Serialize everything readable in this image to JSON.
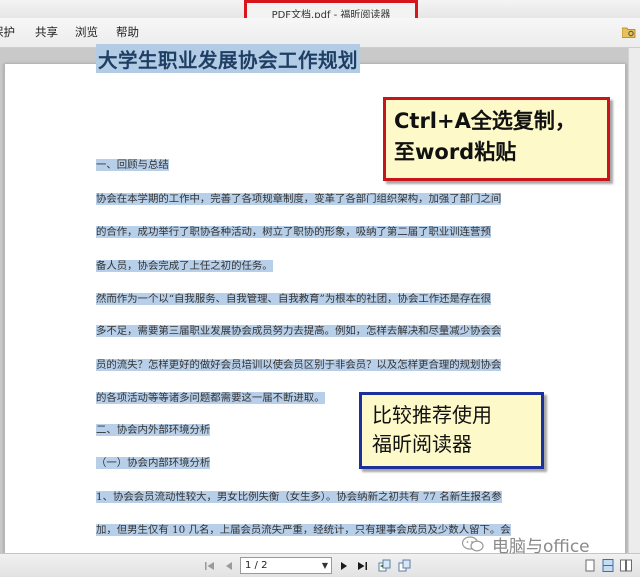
{
  "window": {
    "title": "PDF文档.pdf - 福昕阅读器"
  },
  "menu": {
    "items": [
      {
        "label": "保护",
        "name": "menu-protect"
      },
      {
        "label": "共享",
        "name": "menu-share"
      },
      {
        "label": "浏览",
        "name": "menu-view"
      },
      {
        "label": "帮助",
        "name": "menu-help"
      }
    ]
  },
  "document": {
    "title": "大学生职业发展协会工作规划",
    "lines": [
      {
        "text": "一、回顾与总结",
        "highlight": true
      },
      {
        "text": "协会在本学期的工作中，完善了各项规章制度，变革了各部门组织架构，加强了部门之间",
        "highlight": true
      },
      {
        "text": "的合作，成功举行了职协各种活动，树立了职协的形象，吸纳了第二届了职业训连营预",
        "highlight": true
      },
      {
        "text": "备人员，协会完成了上任之初的任务。",
        "highlight": true
      },
      {
        "text": "然而作为一个以“自我服务、自我管理、自我教育”为根本的社团，协会工作还是存在很",
        "highlight": true
      },
      {
        "text": "多不足，需要第三届职业发展协会成员努力去提高。例如，怎样去解决和尽量减少协会会",
        "highlight": true
      },
      {
        "text": "员的流失？怎样更好的做好会员培训以使会员区别于非会员？以及怎样更合理的规划协会",
        "highlight": true
      },
      {
        "text": "的各项活动等等诸多问题都需要这一届不断进取。",
        "highlight": true
      },
      {
        "text": "二、协会内外部环境分析",
        "highlight": true
      },
      {
        "text": "（一）协会内部环境分析",
        "highlight": true
      },
      {
        "text": "1、协会会员流动性较大，男女比例失衡（女生多）。协会纳新之初共有 77 名新生报名参",
        "highlight": true
      },
      {
        "text": "加，但男生仅有 10 几名，上届会员流失严重，经统计，只有理事会成员及少数人留下。会",
        "highlight": true
      }
    ]
  },
  "callouts": {
    "red": {
      "line1": "Ctrl+A全选复制，",
      "line2": "至word粘贴"
    },
    "blue": {
      "line1": "比较推荐使用",
      "line2": "福昕阅读器"
    }
  },
  "statusbar": {
    "page_indicator": "1 / 2"
  },
  "watermark": {
    "text": "电脑与office"
  },
  "colors": {
    "red_frame": "#d8141c",
    "blue_frame": "#1c2f9c",
    "note_bg": "#fdf9c8",
    "highlight": "#b3cce6"
  }
}
